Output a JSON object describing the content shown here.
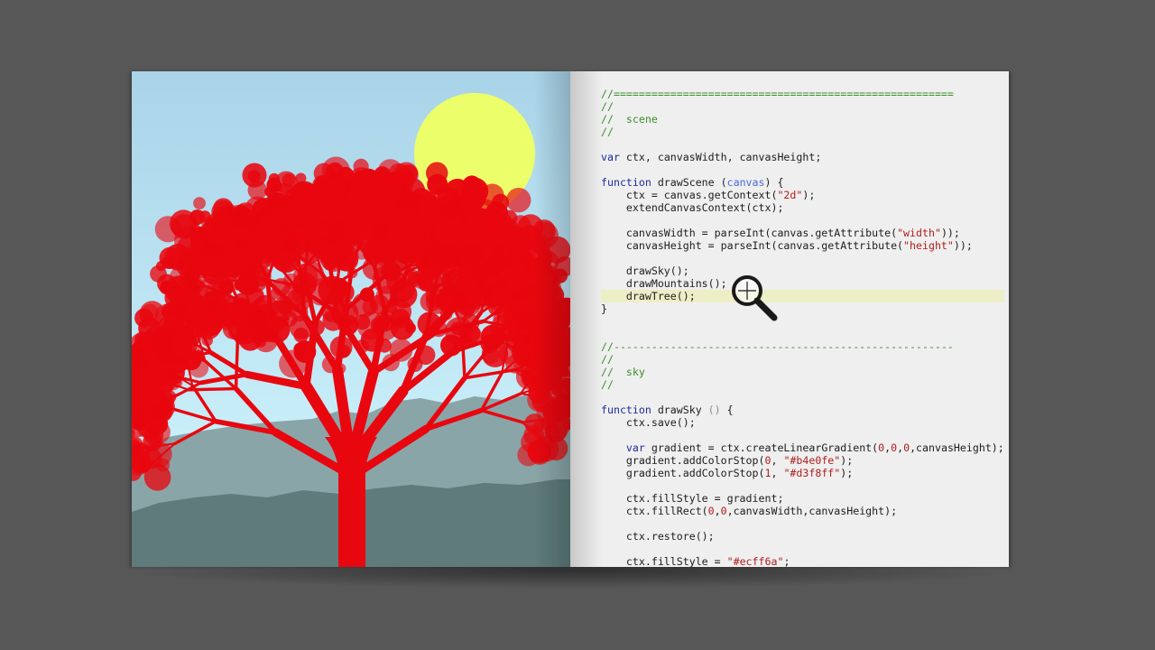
{
  "illustration": {
    "colors": {
      "sky_top": "#a9d3e8",
      "sky_bottom": "#d3f8ff",
      "sun": "#ecff6a",
      "tree": "#e8070f",
      "mountain_far": "#8aa5a8",
      "mountain_near": "#5f7b7c"
    }
  },
  "code_lines": [
    "//======================================================",
    "//",
    "//  scene",
    "//",
    "",
    "var ctx, canvasWidth, canvasHeight;",
    "",
    "function drawScene (canvas) {",
    "    ctx = canvas.getContext(\"2d\");",
    "    extendCanvasContext(ctx);",
    "",
    "    canvasWidth = parseInt(canvas.getAttribute(\"width\"));",
    "    canvasHeight = parseInt(canvas.getAttribute(\"height\"));",
    "",
    "    drawSky();",
    "    drawMountains();",
    "    drawTree();",
    "}",
    "",
    "",
    "//------------------------------------------------------",
    "//",
    "//  sky",
    "//",
    "",
    "function drawSky () {",
    "    ctx.save();",
    "",
    "    var gradient = ctx.createLinearGradient(0,0,0,canvasHeight);",
    "    gradient.addColorStop(0, \"#b4e0fe\");",
    "    gradient.addColorStop(1, \"#d3f8ff\");",
    "",
    "    ctx.fillStyle = gradient;",
    "    ctx.fillRect(0,0,canvasWidth,canvasHeight);",
    "",
    "    ctx.restore();",
    "",
    "    ctx.fillStyle = \"#ecff6a\";"
  ],
  "highlighted_line": 16,
  "cursor": {
    "icon": "magnifier-cursor-icon"
  },
  "code_colors": {
    "comment": "#3b8e2c",
    "keyword": "#1f2a9e",
    "string": "#b01d1d",
    "param": "#4a6ad8",
    "highlight": "#ecefc6"
  }
}
